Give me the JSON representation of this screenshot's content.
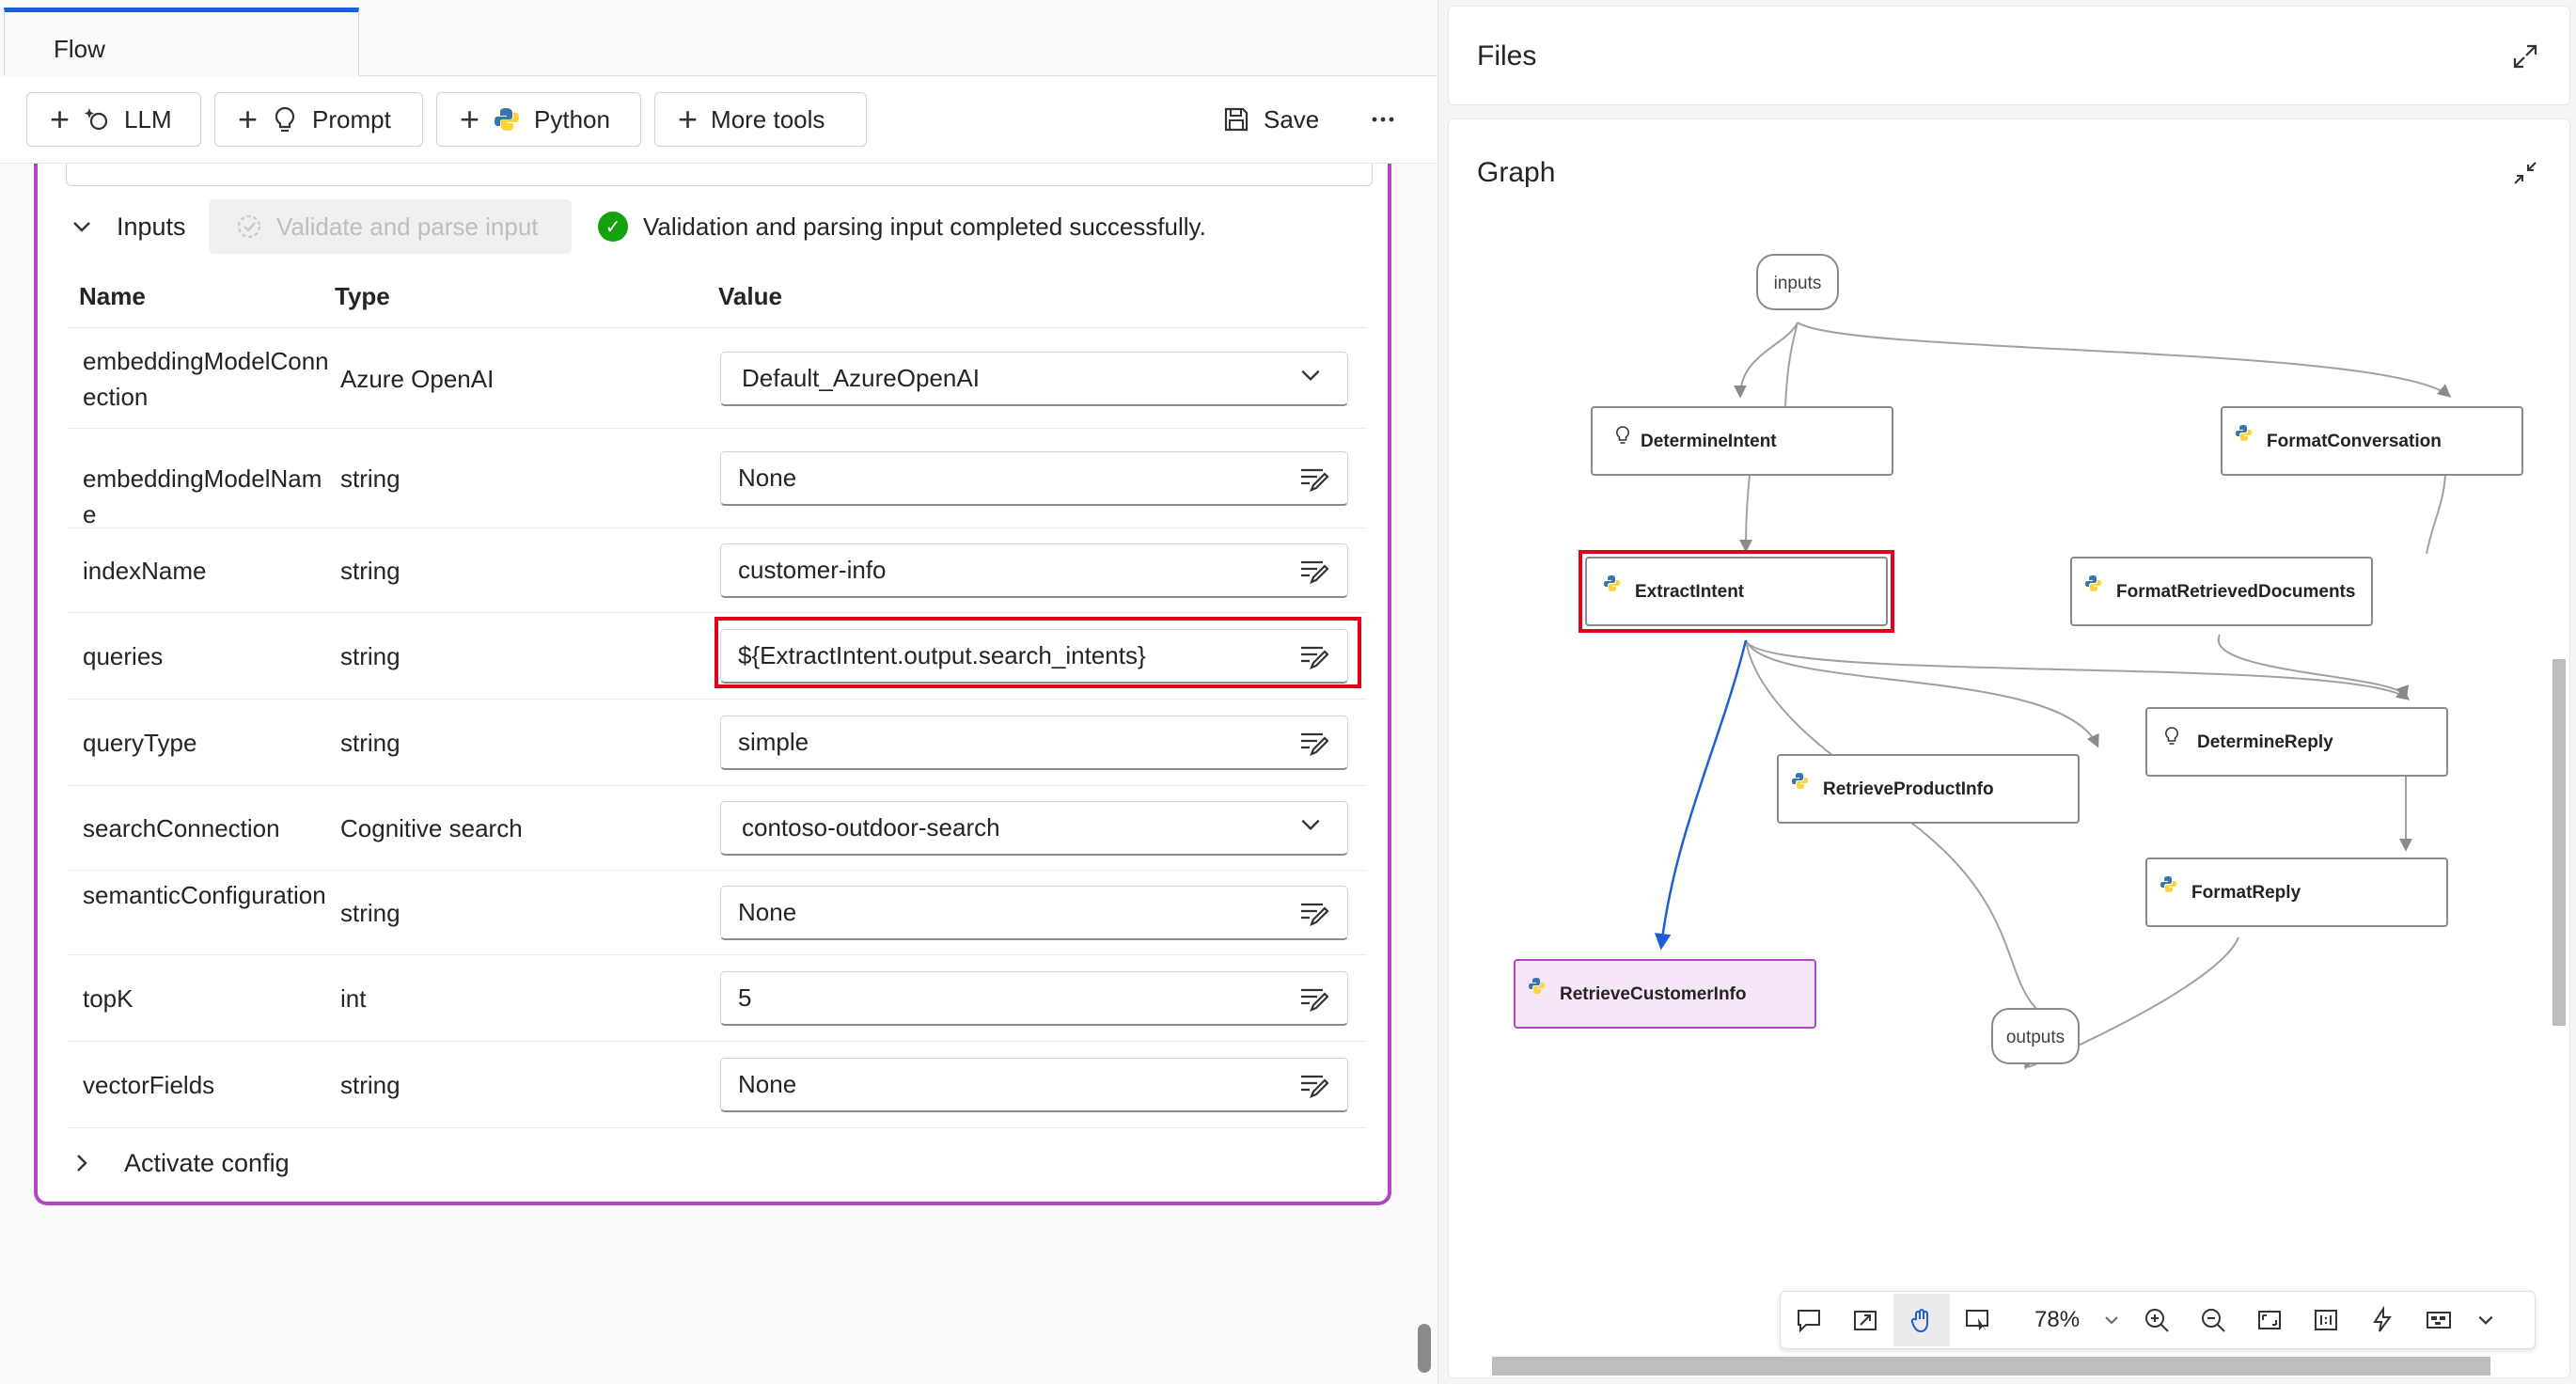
{
  "flow_tab": {
    "label": "Flow"
  },
  "toolbar": {
    "llm_label": "LLM",
    "prompt_label": "Prompt",
    "python_label": "Python",
    "more_tools_label": "More tools",
    "save_label": "Save",
    "more_icon": "ellipsis-icon"
  },
  "inputs_section": {
    "title": "Inputs",
    "validate_label": "Validate and parse input",
    "validation_message": "Validation and parsing input completed successfully.",
    "columns": {
      "name": "Name",
      "type": "Type",
      "value": "Value"
    },
    "rows": [
      {
        "name": "embeddingModelConnection",
        "type": "Azure OpenAI",
        "value": "Default_AzureOpenAI",
        "control": "dropdown"
      },
      {
        "name": "embeddingModelName",
        "type": "string",
        "value": "None",
        "control": "text"
      },
      {
        "name": "indexName",
        "type": "string",
        "value": "customer-info",
        "control": "text"
      },
      {
        "name": "queries",
        "type": "string",
        "value": "${ExtractIntent.output.search_intents}",
        "control": "text"
      },
      {
        "name": "queryType",
        "type": "string",
        "value": "simple",
        "control": "text"
      },
      {
        "name": "searchConnection",
        "type": "Cognitive search",
        "value": "contoso-outdoor-search",
        "control": "dropdown"
      },
      {
        "name": "semanticConfiguration",
        "type": "string",
        "value": "None",
        "control": "text"
      },
      {
        "name": "topK",
        "type": "int",
        "value": "5",
        "control": "text"
      },
      {
        "name": "vectorFields",
        "type": "string",
        "value": "None",
        "control": "text"
      }
    ]
  },
  "activate_config": {
    "label": "Activate config"
  },
  "files_panel": {
    "title": "Files"
  },
  "graph_panel": {
    "title": "Graph",
    "zoom": "78%",
    "nodes": {
      "inputs": "inputs",
      "outputs": "outputs",
      "determine_intent": "DetermineIntent",
      "format_conversation": "FormatConversation",
      "extract_intent": "ExtractIntent",
      "format_retrieved_documents": "FormatRetrievedDocuments",
      "determine_reply": "DetermineReply",
      "retrieve_product_info": "RetrieveProductInfo",
      "format_reply": "FormatReply",
      "retrieve_customer_info": "RetrieveCustomerInfo"
    }
  },
  "colors": {
    "accent": "#1a5fd6",
    "node_border_selected": "#b146c2",
    "highlight": "#e3001b",
    "success": "#13a10e",
    "selected_node_fill": "#f7e6f7"
  }
}
